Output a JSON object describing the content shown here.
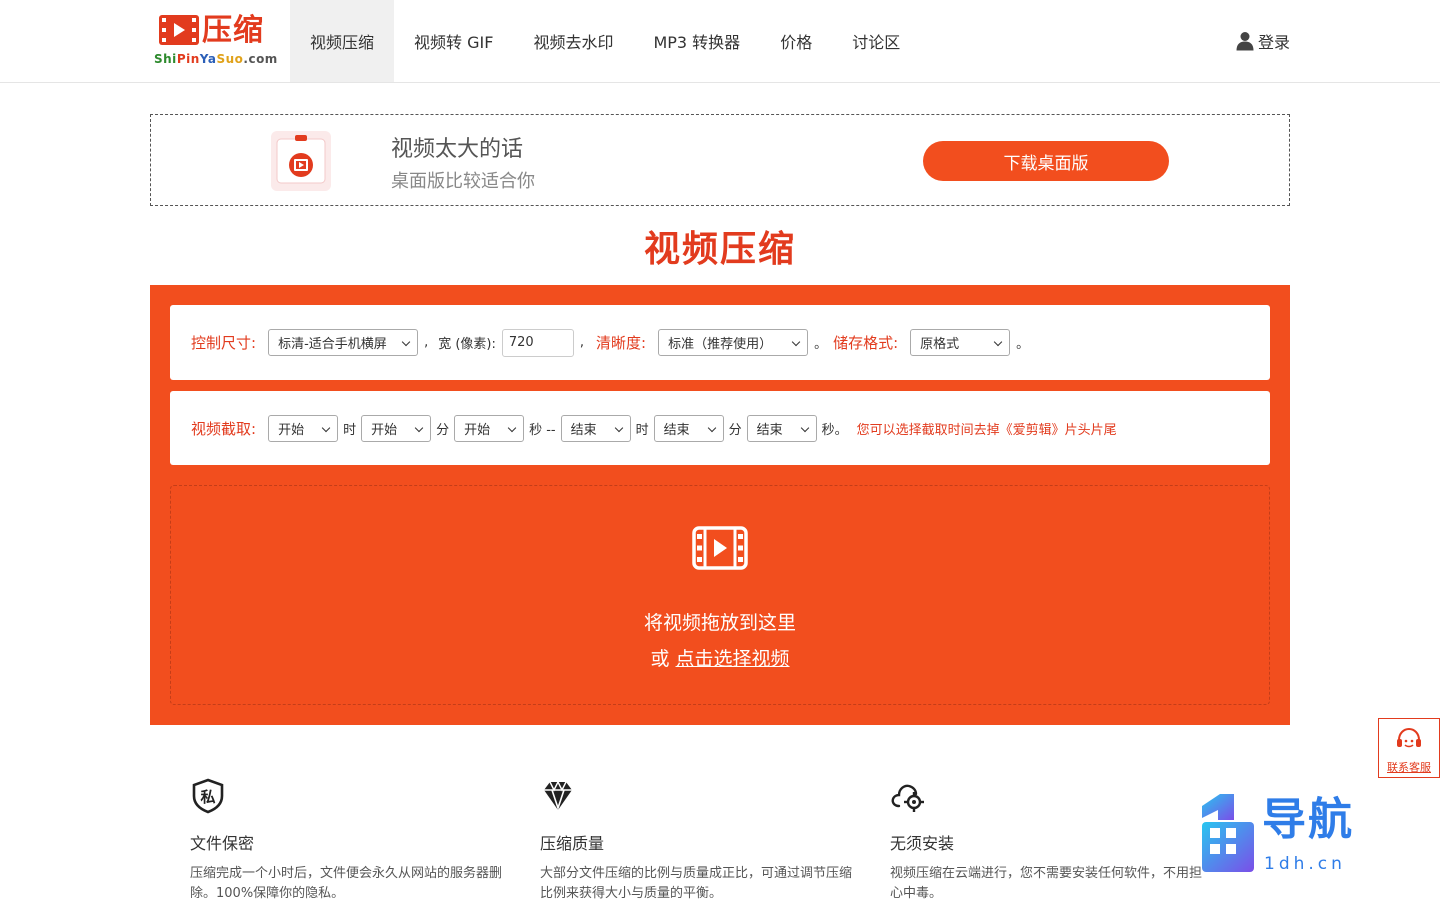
{
  "header": {
    "logo_text": "压缩",
    "logo_domain": [
      "Shi",
      "Pin",
      "Ya",
      "Suo",
      ".com"
    ],
    "nav": [
      {
        "label": "视频压缩",
        "active": true
      },
      {
        "label": "视频转 GIF",
        "active": false
      },
      {
        "label": "视频去水印",
        "active": false
      },
      {
        "label": "MP3 转换器",
        "active": false
      },
      {
        "label": "价格",
        "active": false
      },
      {
        "label": "讨论区",
        "active": false
      }
    ],
    "login_label": "登录"
  },
  "banner": {
    "line1": "视频太大的话",
    "line2": "桌面版比较适合你",
    "button_label": "下载桌面版"
  },
  "page_title": "视频压缩",
  "settings": {
    "size_label": "控制尺寸:",
    "size_value": "标清-适合手机横屏",
    "comma": ",",
    "width_label": "宽 (像素):",
    "width_value": "720",
    "clarity_label": "清晰度:",
    "clarity_value": "标准（推荐使用）",
    "period": "。",
    "format_label": "储存格式:",
    "format_value": "原格式"
  },
  "trim": {
    "label": "视频截取:",
    "start_hour": "开始",
    "hour_unit": "时",
    "start_minute": "开始",
    "minute_unit": "分",
    "start_second": "开始",
    "second_unit_dash": "秒 --",
    "end_hour": "结束",
    "end_minute": "结束",
    "end_second": "结束",
    "second_end": "秒。",
    "hint": "您可以选择截取时间去掉《爱剪辑》片头片尾"
  },
  "dropzone": {
    "line1": "将视频拖放到这里",
    "or": "或",
    "link": "点击选择视频"
  },
  "features": [
    {
      "icon": "shield-private-icon",
      "title": "文件保密",
      "desc": "压缩完成一个小时后，文件便会永久从网站的服务器删除。100%保障你的隐私。"
    },
    {
      "icon": "diamond-icon",
      "title": "压缩质量",
      "desc": "大部分文件压缩的比例与质量成正比，可通过调节压缩比例来获得大小与质量的平衡。"
    },
    {
      "icon": "cloud-gear-icon",
      "title": "无须安装",
      "desc": "视频压缩在云端进行，您不需要安装任何软件，不用担心中毒。"
    }
  ],
  "service_label": "联系客服",
  "watermark": {
    "text": "导航",
    "domain": "1dh.cn"
  },
  "colors": {
    "accent": "#f24e1e",
    "title": "#e23b1e",
    "watermark": "#2f7de8"
  }
}
